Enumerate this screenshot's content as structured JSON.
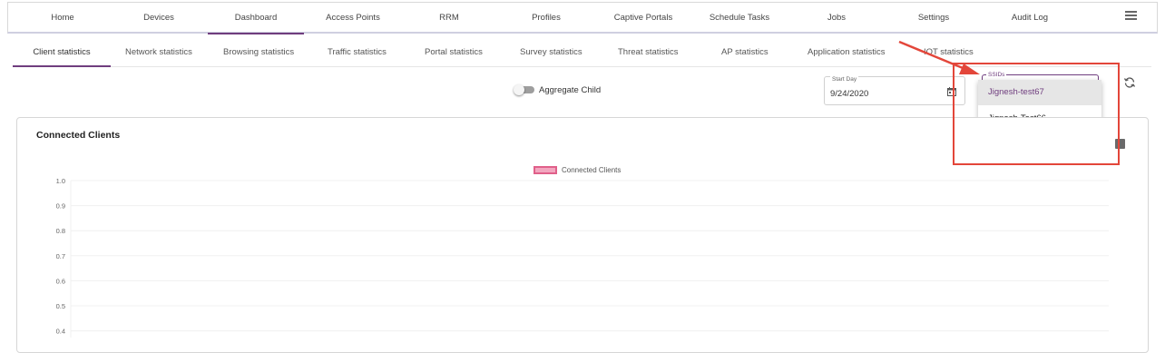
{
  "topnav": {
    "items": [
      "Home",
      "Devices",
      "Dashboard",
      "Access Points",
      "RRM",
      "Profiles",
      "Captive Portals",
      "Schedule Tasks",
      "Jobs",
      "Settings",
      "Audit Log"
    ],
    "active": "Dashboard"
  },
  "subtabs": {
    "items": [
      "Client statistics",
      "Network statistics",
      "Browsing statistics",
      "Traffic statistics",
      "Portal statistics",
      "Survey statistics",
      "Threat statistics",
      "AP statistics",
      "Application statistics",
      "IOT statistics"
    ],
    "active": "Client statistics"
  },
  "filters": {
    "aggregate_label": "Aggregate Child",
    "aggregate_on": false,
    "start_day_label": "Start Day",
    "start_day_value": "9/24/2020",
    "ssid_label": "SSIDs",
    "ssid_options": [
      "Jignesh-test67",
      "Jignesh-Test66"
    ],
    "ssid_selected": "Jignesh-test67"
  },
  "card": {
    "title": "Connected Clients"
  },
  "colors": {
    "accent": "#6f3d7e",
    "annotation": "#e3463a",
    "series_fill": "#f2a6bf",
    "series_border": "#e0608a"
  },
  "chart_data": {
    "type": "bar",
    "series": [
      {
        "name": "Connected Clients",
        "values": []
      }
    ],
    "y_ticks": [
      "1.0",
      "0.9",
      "0.8",
      "0.7",
      "0.6",
      "0.5",
      "0.4"
    ],
    "ylim": [
      0,
      1.0
    ],
    "grid": true,
    "legend": "top-center"
  }
}
